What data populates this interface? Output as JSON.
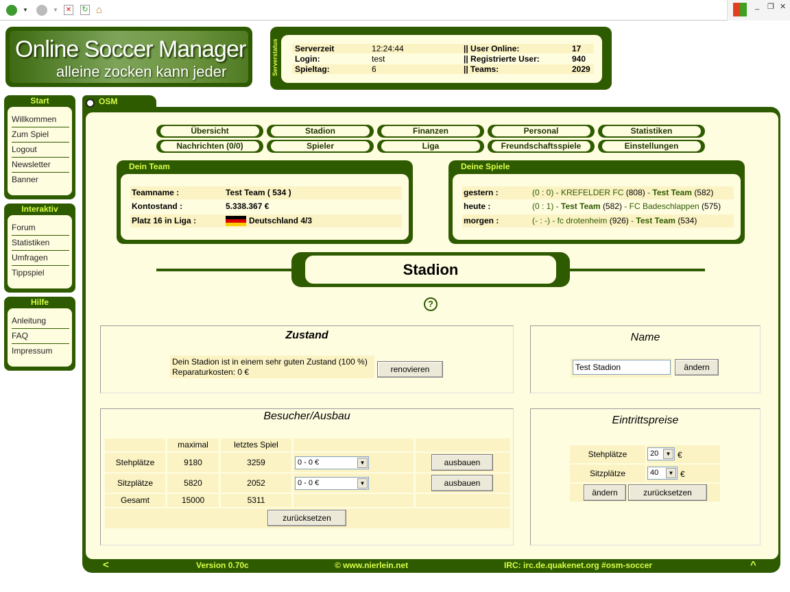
{
  "browser": {
    "back_icon": "back-arrow-icon",
    "forward_icon": "forward-arrow-icon"
  },
  "logo": {
    "title": "Online Soccer Manager",
    "subtitle": "alleine zocken kann jeder"
  },
  "serverstatus": {
    "side_label": "Serverstatus",
    "rows": [
      {
        "l1": "Serverzeit",
        "v1": "12:24:44",
        "l2": "|| User Online:",
        "v2": "17"
      },
      {
        "l1": "Login:",
        "v1": "test",
        "l2": "|| Registrierte User:",
        "v2": "940"
      },
      {
        "l1": "Spieltag:",
        "v1": "6",
        "l2": "|| Teams:",
        "v2": "2029"
      }
    ]
  },
  "menu": {
    "start": {
      "title": "Start",
      "items": [
        "Willkommen",
        "Zum Spiel",
        "Logout",
        "Newsletter",
        "Banner"
      ]
    },
    "interaktiv": {
      "title": "Interaktiv",
      "items": [
        "Forum",
        "Statistiken",
        "Umfragen",
        "Tippspiel"
      ]
    },
    "hilfe": {
      "title": "Hilfe",
      "items": [
        "Anleitung",
        "FAQ",
        "Impressum"
      ]
    }
  },
  "tab": {
    "label": "OSM"
  },
  "nav": [
    [
      "Übersicht",
      "Stadion",
      "Finanzen",
      "Personal",
      "Statistiken"
    ],
    [
      "Nachrichten (0/0)",
      "Spieler",
      "Liga",
      "Freundschaftsspiele",
      "Einstellungen"
    ]
  ],
  "team": {
    "title": "Dein Team",
    "rows": [
      {
        "label": "Teamname :",
        "value": "Test Team ( 534 )"
      },
      {
        "label": "Kontostand :",
        "value": "5.338.367 €"
      },
      {
        "label": "Platz 16 in Liga :",
        "value": "Deutschland 4/3"
      }
    ]
  },
  "games": {
    "title": "Deine Spiele",
    "rows": [
      {
        "label": "gestern :",
        "score": "(0 : 0)",
        "sep1": " - ",
        "home": "KREFELDER FC",
        "home_id": "(808)",
        "sep2": " - ",
        "away": "Test Team",
        "away_id": "(582)"
      },
      {
        "label": "heute :",
        "score": "(0 : 1)",
        "sep1": " - ",
        "home": "Test Team",
        "home_id": "(582)",
        "sep2": " - ",
        "away": "FC Badeschlappen",
        "away_id": "(575)"
      },
      {
        "label": "morgen :",
        "score": "(- : -)",
        "sep1": " - ",
        "home": "fc drotenheim",
        "home_id": "(926)",
        "sep2": " - ",
        "away": "Test Team",
        "away_id": "(534)"
      }
    ]
  },
  "stadion": {
    "title": "Stadion",
    "help": "?"
  },
  "zustand": {
    "title": "Zustand",
    "line1": "Dein Stadion ist in einem sehr guten Zustand (100 %)",
    "line2": "Reparaturkosten: 0 €",
    "button": "renovieren"
  },
  "name": {
    "title": "Name",
    "value": "Test Stadion",
    "button": "ändern"
  },
  "besucher": {
    "title": "Besucher/Ausbau",
    "headers": [
      "",
      "maximal",
      "letztes Spiel",
      "",
      ""
    ],
    "rows": [
      {
        "label": "Stehplätze",
        "max": "9180",
        "last": "3259",
        "select": "0 - 0 €",
        "button": "ausbauen"
      },
      {
        "label": "Sitzplätze",
        "max": "5820",
        "last": "2052",
        "select": "0 - 0 €",
        "button": "ausbauen"
      }
    ],
    "total": {
      "label": "Gesamt",
      "max": "15000",
      "last": "5311"
    },
    "reset": "zurücksetzen"
  },
  "preise": {
    "title": "Eintrittspreise",
    "rows": [
      {
        "label": "Stehplätze",
        "value": "20",
        "unit": "€"
      },
      {
        "label": "Sitzplätze",
        "value": "40",
        "unit": "€"
      }
    ],
    "change": "ändern",
    "reset": "zurücksetzen"
  },
  "footer": {
    "left": "<",
    "version": "Version 0.70c",
    "copyright": "© www.nierlein.net",
    "irc": "IRC: irc.de.quakenet.org #osm-soccer",
    "up": "^"
  }
}
